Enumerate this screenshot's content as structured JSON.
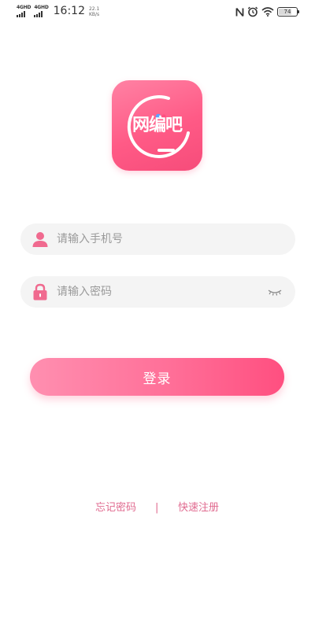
{
  "status_bar": {
    "network_1": "4GHD",
    "network_2": "4GHD",
    "time": "16:12",
    "speed_value": "22.1",
    "speed_unit": "KB/s",
    "battery": "74",
    "battery_level": 0.74,
    "icons": [
      "signal-bars-icon",
      "nfc-icon",
      "alarm-icon",
      "wifi-icon",
      "battery-icon"
    ]
  },
  "logo": {
    "text": "网编吧",
    "colors": {
      "gradient_start": "#ff82a4",
      "gradient_end": "#f64c7a",
      "dot_blue": "#5aa2ff",
      "dot_pink": "#ff4f80"
    }
  },
  "form": {
    "phone": {
      "placeholder": "请输入手机号",
      "value": "",
      "icon": "user-icon"
    },
    "password": {
      "placeholder": "请输入密码",
      "value": "",
      "icon": "lock-icon",
      "toggle_icon": "eye-closed-icon"
    },
    "login_label": "登录"
  },
  "footer": {
    "forgot_label": "忘记密码",
    "separator": "|",
    "register_label": "快速注册"
  },
  "theme": {
    "accent": "#ff6f98",
    "link": "#e06a8f",
    "input_bg": "#f4f4f4"
  }
}
